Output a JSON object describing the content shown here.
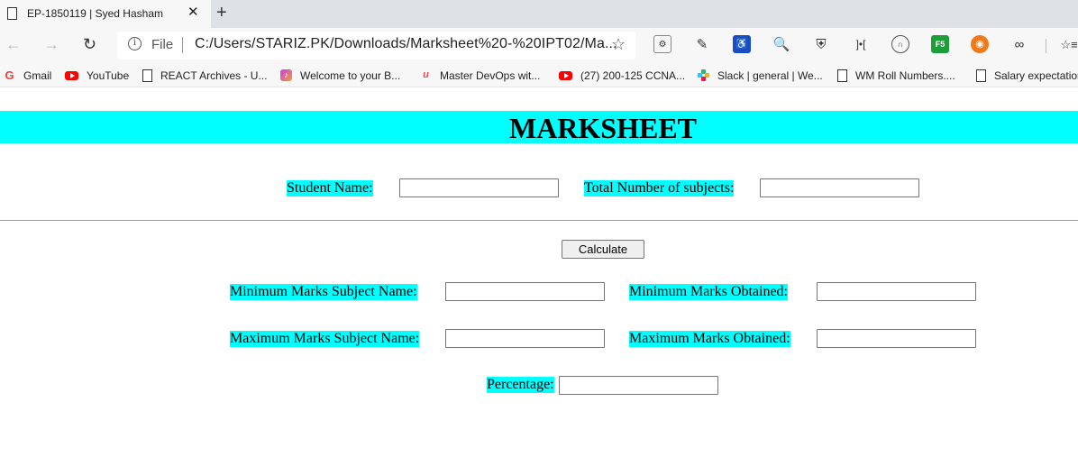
{
  "browser": {
    "tab": {
      "title": "EP-1850119 | Syed Hasham",
      "close_glyph": "✕",
      "icon": "page-icon"
    },
    "new_tab_glyph": "+",
    "nav": {
      "back_glyph": "←",
      "forward_glyph": "→",
      "refresh_glyph": "↻"
    },
    "address_bar": {
      "info_glyph": "i",
      "scheme_label": "File",
      "url": "C:/Users/STARIZ.PK/Downloads/Marksheet%20-%20IPT02/Ma...",
      "star_glyph": "☆"
    },
    "extensions": [
      {
        "name": "puzzle-extension-icon",
        "glyph": "⚙"
      },
      {
        "name": "pen-extension-icon",
        "glyph": "✎"
      },
      {
        "name": "accessibility-extension-icon",
        "glyph": "♿"
      },
      {
        "name": "magnifier-extension-icon",
        "glyph": "🔍"
      },
      {
        "name": "shield-extension-icon",
        "glyph": "⛨"
      },
      {
        "name": "brackets-extension-icon",
        "glyph": "]•["
      },
      {
        "name": "headphones-extension-icon",
        "glyph": "∩"
      },
      {
        "name": "f5-extension-icon",
        "glyph": "F5"
      },
      {
        "name": "orange-extension-icon",
        "glyph": "◉"
      },
      {
        "name": "glasses-extension-icon",
        "glyph": "∞"
      },
      {
        "name": "favorites-icon",
        "glyph": "☆≡"
      }
    ],
    "bookmarks": [
      {
        "label": "Gmail",
        "icon": "google-icon"
      },
      {
        "label": "YouTube",
        "icon": "youtube-icon"
      },
      {
        "label": "REACT Archives - U...",
        "icon": "page-icon"
      },
      {
        "label": "Welcome to your B...",
        "icon": "music-icon"
      },
      {
        "label": "Master DevOps wit...",
        "icon": "udemy-icon"
      },
      {
        "label": "(27) 200-125 CCNA...",
        "icon": "youtube-icon"
      },
      {
        "label": "Slack | general | We...",
        "icon": "slack-icon"
      },
      {
        "label": "WM Roll Numbers....",
        "icon": "page-icon"
      },
      {
        "label": "Salary expectation",
        "icon": "page-icon"
      }
    ]
  },
  "page": {
    "title": "MARKSHEET",
    "accent_color": "#00ffff",
    "form": {
      "student_name_label": "Student Name:",
      "student_name_value": "",
      "total_subjects_label": "Total Number of subjects:",
      "total_subjects_value": "",
      "calculate_label": "Calculate",
      "min_subject_label": "Minimum Marks Subject Name:",
      "min_subject_value": "",
      "min_obtained_label": "Minimum Marks Obtained:",
      "min_obtained_value": "",
      "max_subject_label": "Maximum Marks Subject Name:",
      "max_subject_value": "",
      "max_obtained_label": "Maximum Marks Obtained:",
      "max_obtained_value": "",
      "percentage_label": "Percentage:",
      "percentage_value": ""
    }
  }
}
